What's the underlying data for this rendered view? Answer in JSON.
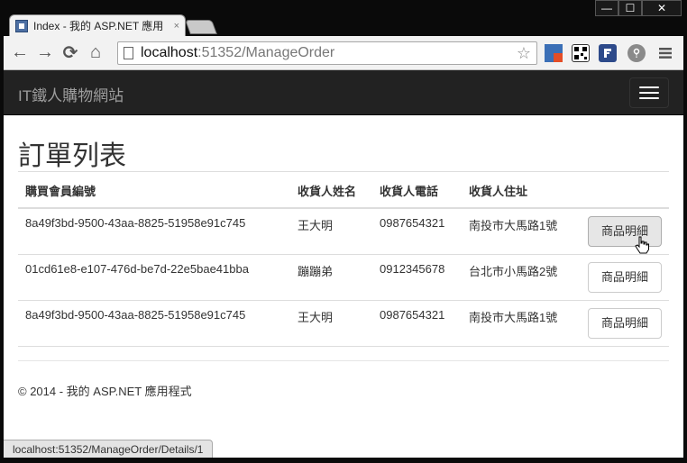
{
  "browser": {
    "tab_title": "Index - 我的 ASP.NET 應用",
    "tab_close": "×",
    "url_host": "localhost",
    "url_rest": ":51352/ManageOrder",
    "status_url": "localhost:51352/ManageOrder/Details/1",
    "window_controls": {
      "minimize": "—",
      "maximize": "☐",
      "close": "✕"
    },
    "nav": {
      "back": "←",
      "forward": "→",
      "reload": "⟳",
      "home": "⌂"
    },
    "bookmark_star": "☆"
  },
  "site": {
    "brand": "IT鐵人購物網站"
  },
  "main": {
    "title": "訂單列表",
    "columns": [
      "購買會員編號",
      "收貨人姓名",
      "收貨人電話",
      "收貨人住址",
      ""
    ],
    "rows": [
      {
        "member_id": "8a49f3bd-9500-43aa-8825-51958e91c745",
        "name": "王大明",
        "phone": "0987654321",
        "address": "南投市大馬路1號",
        "action": "商品明細"
      },
      {
        "member_id": "01cd61e8-e107-476d-be7d-22e5bae41bba",
        "name": "蹦蹦弟",
        "phone": "0912345678",
        "address": "台北市小馬路2號",
        "action": "商品明細"
      },
      {
        "member_id": "8a49f3bd-9500-43aa-8825-51958e91c745",
        "name": "王大明",
        "phone": "0987654321",
        "address": "南投市大馬路1號",
        "action": "商品明細"
      }
    ]
  },
  "footer": {
    "text": "© 2014 - 我的 ASP.NET 應用程式"
  },
  "colors": {
    "navbar": "#222222",
    "brand_text": "#9d9d9d",
    "chrome_frame": "#0a0a0a"
  }
}
